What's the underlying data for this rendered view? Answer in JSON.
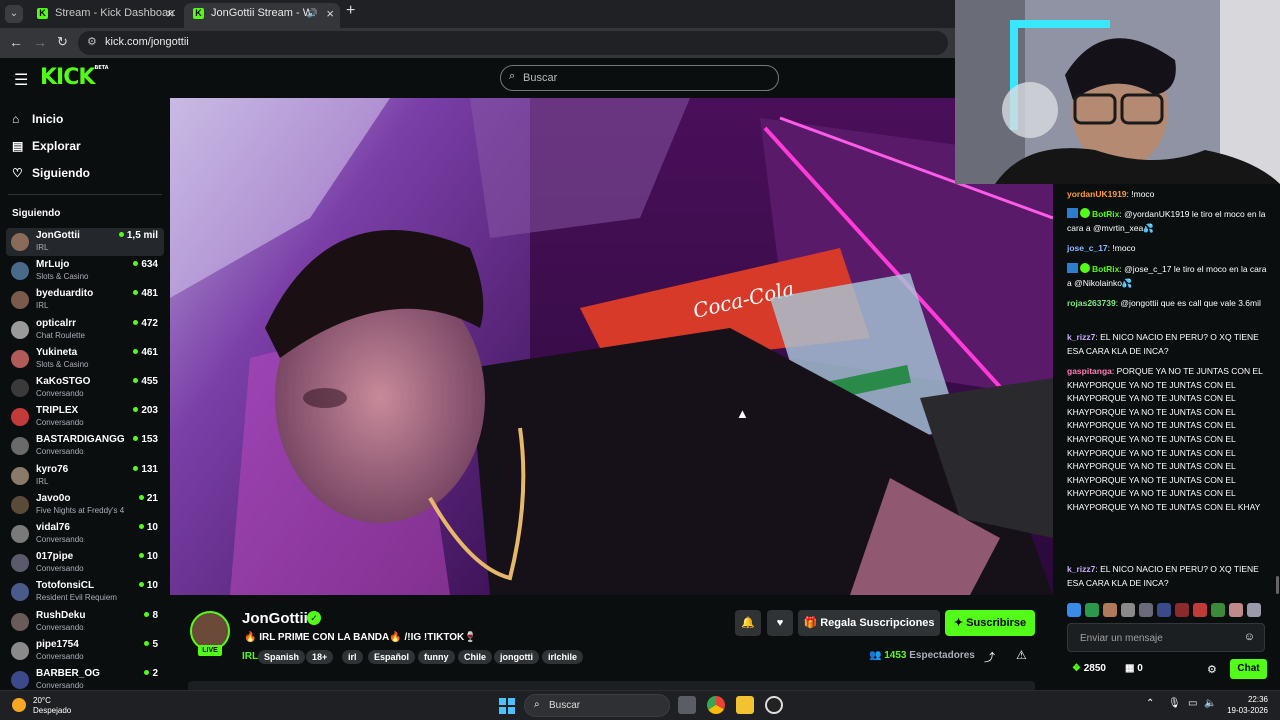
{
  "browser": {
    "tabs": [
      {
        "title": "Stream - Kick Dashboard",
        "active": false
      },
      {
        "title": "JonGottii Stream - Watch L",
        "active": true
      }
    ],
    "url": "kick.com/jongottii"
  },
  "kick": {
    "search_placeholder": "Buscar",
    "nav": [
      "Inicio",
      "Explorar",
      "Siguiendo"
    ],
    "following_title": "Siguiendo",
    "following": [
      {
        "name": "JonGottii",
        "category": "IRL",
        "viewers": "1,5 mil",
        "selected": true,
        "avatar": "#8a6a58"
      },
      {
        "name": "MrLujo",
        "category": "Slots & Casino",
        "viewers": "634",
        "avatar": "#4a6a8a"
      },
      {
        "name": "byeduardito",
        "category": "IRL",
        "viewers": "481",
        "avatar": "#7a5a4a"
      },
      {
        "name": "opticalrr",
        "category": "Chat Roulette",
        "viewers": "472",
        "avatar": "#9a9a9a"
      },
      {
        "name": "Yukineta",
        "category": "Slots & Casino",
        "viewers": "461",
        "avatar": "#b05a5a"
      },
      {
        "name": "KaKoSTGO",
        "category": "Conversando",
        "viewers": "455",
        "avatar": "#3a3a3a"
      },
      {
        "name": "TRIPLEX",
        "category": "Conversando",
        "viewers": "203",
        "avatar": "#c23a3a"
      },
      {
        "name": "BASTARDIGANGG",
        "category": "Conversando",
        "viewers": "153",
        "avatar": "#6a6a6a"
      },
      {
        "name": "kyro76",
        "category": "IRL",
        "viewers": "131",
        "avatar": "#8a7a6a"
      },
      {
        "name": "Javo0o",
        "category": "Five Nights at Freddy's 4",
        "viewers": "21",
        "avatar": "#5a4a3a"
      },
      {
        "name": "vidal76",
        "category": "Conversando",
        "viewers": "10",
        "avatar": "#7a7a7a"
      },
      {
        "name": "017pipe",
        "category": "Conversando",
        "viewers": "10",
        "avatar": "#5a5a6a"
      },
      {
        "name": "TotofonsiCL",
        "category": "Resident Evil Requiem",
        "viewers": "10",
        "avatar": "#4a5a8a"
      },
      {
        "name": "RushDeku",
        "category": "Conversando",
        "viewers": "8",
        "avatar": "#6a5a5a"
      },
      {
        "name": "pipe1754",
        "category": "Conversando",
        "viewers": "5",
        "avatar": "#8a8a8a"
      },
      {
        "name": "BARBER_OG",
        "category": "Conversando",
        "viewers": "2",
        "avatar": "#3a4a8a"
      }
    ],
    "stream": {
      "streamer": "JonGottii",
      "live_label": "LIVE",
      "title": "🔥 IRL PRIME CON LA BANDA🔥 /!IG !TIKTOK🍷",
      "category": "IRL",
      "tags": [
        "Spanish",
        "18+",
        "irl",
        "Español",
        "funny",
        "Chile",
        "jongotti",
        "irlchile"
      ],
      "gift_label": "Regala Suscripciones",
      "subscribe_label": "Suscribirse",
      "viewers_count": "1453",
      "viewers_label": "Espectadores"
    },
    "chat": {
      "messages": [
        {
          "user": "yordanUK1919",
          "color": "#ff9b3f",
          "text": "!moco",
          "bot": false
        },
        {
          "user": "BotRix",
          "color": "#53fc18",
          "text": "@yordanUK1919 le tiro el moco en la cara a @mvrtin_xea💦",
          "bot": true
        },
        {
          "user": "jose_c_17",
          "color": "#8fb8ff",
          "text": "!moco",
          "bot": false
        },
        {
          "user": "BotRix",
          "color": "#53fc18",
          "text": "@jose_c_17 le tiro el moco en la cara a @Nikolainko💦",
          "bot": true
        },
        {
          "user": "rojas263739",
          "color": "#7fe87f",
          "text": "@jongottii que es call que vale 3.6mil",
          "bot": false
        },
        {
          "user": "k_rizz7",
          "color": "#c9a8ff",
          "text": "EL NICO NACIO EN PERU? O XQ TIENE ESA CARA KLA DE INCA?",
          "bot": false
        },
        {
          "user": "gaspitanga",
          "color": "#ff7ab8",
          "text": "PORQUE YA NO TE JUNTAS CON EL KHAYPORQUE YA NO TE JUNTAS CON EL KHAYPORQUE YA NO TE JUNTAS CON EL KHAYPORQUE YA NO TE JUNTAS CON EL KHAYPORQUE YA NO TE JUNTAS CON EL KHAYPORQUE YA NO TE JUNTAS CON EL KHAYPORQUE YA NO TE JUNTAS CON EL KHAYPORQUE YA NO TE JUNTAS CON EL KHAYPORQUE YA NO TE JUNTAS CON EL KHAYPORQUE YA NO TE JUNTAS CON EL KHAYPORQUE YA NO TE JUNTAS CON EL KHAY",
          "bot": false
        },
        {
          "user": "k_rizz7",
          "color": "#c9a8ff",
          "text": "EL NICO NACIO EN PERU? O XQ TIENE ESA CARA KLA DE INCA?",
          "bot": false
        }
      ],
      "input_placeholder": "Enviar un mensaje",
      "points": "2850",
      "boxes": "0",
      "chat_button": "Chat"
    }
  },
  "video": {
    "sign_text": "Coca-Cola"
  },
  "taskbar": {
    "temp": "20°C",
    "weather": "Despejado",
    "search": "Buscar",
    "time": "22:36",
    "date": "19-03-2026"
  },
  "colors": {
    "accent": "#53fc18",
    "bg": "#0b0e0f"
  }
}
